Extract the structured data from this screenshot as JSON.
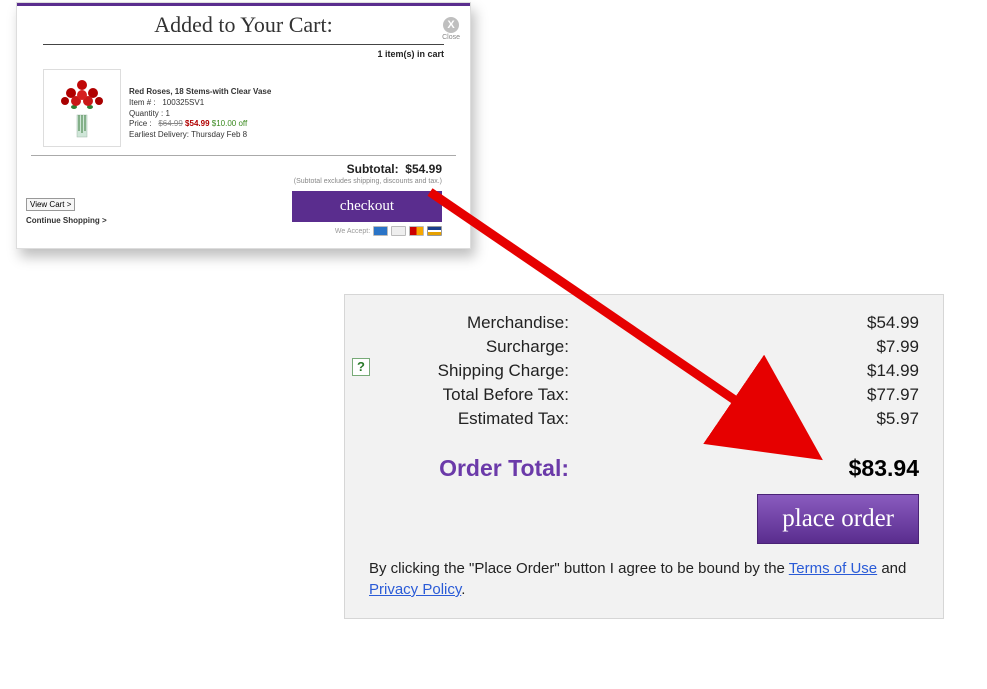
{
  "cart": {
    "title": "Added to Your Cart:",
    "close_label": "Close",
    "close_icon": "X",
    "items_in_cart": "1 item(s) in cart",
    "product": {
      "name": "Red Roses, 18 Stems-with Clear Vase",
      "item_label": "Item # :",
      "item_number": "100325SV1",
      "qty_label": "Quantity :",
      "qty": "1",
      "price_label": "Price :",
      "price_original": "$64.99",
      "price_new": "$54.99",
      "price_save": "$10.00 off",
      "delivery_label": "Earliest Delivery:",
      "delivery_value": "Thursday Feb 8"
    },
    "view_cart": "View Cart >",
    "continue_shopping": "Continue Shopping >",
    "subtotal_label": "Subtotal:",
    "subtotal_value": "$54.99",
    "subtotal_note": "(Subtotal excludes shipping, discounts and tax.)",
    "checkout": "checkout",
    "we_accept": "We Accept:"
  },
  "summary": {
    "lines": [
      {
        "label": "Merchandise:",
        "value": "$54.99"
      },
      {
        "label": "Surcharge:",
        "value": "$7.99"
      },
      {
        "label": "Shipping Charge:",
        "value": "$14.99"
      },
      {
        "label": "Total Before Tax:",
        "value": "$77.97"
      },
      {
        "label": "Estimated Tax:",
        "value": "$5.97"
      }
    ],
    "help_icon": "?",
    "order_total_label": "Order Total:",
    "order_total_value": "$83.94",
    "place_order": "place order",
    "agree_prefix": "By clicking the \"Place Order\" button I agree to be bound by the ",
    "terms": "Terms of Use",
    "and": " and ",
    "privacy": "Privacy Policy",
    "period": "."
  }
}
